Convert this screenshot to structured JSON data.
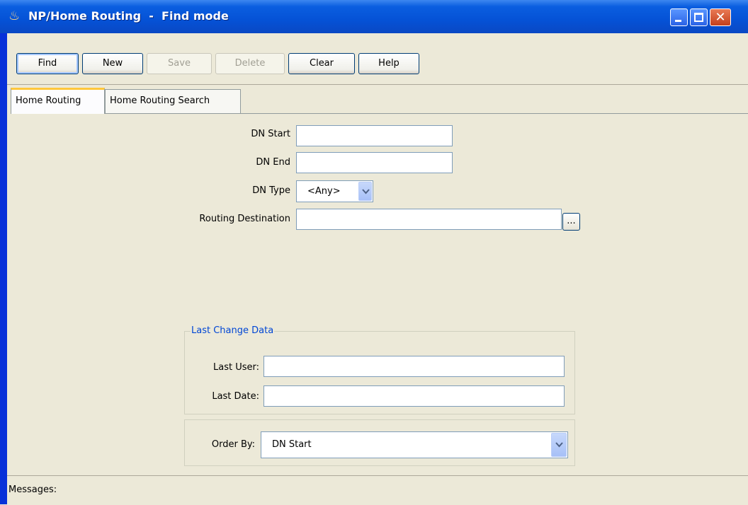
{
  "window": {
    "title": "NP/Home Routing  -  Find mode",
    "app_icon": "java-cup-icon",
    "controls": {
      "minimize": "minimize-icon",
      "maximize": "maximize-icon",
      "close": "close-icon",
      "close_glyph": "✕"
    }
  },
  "toolbar": {
    "find": "Find",
    "new": "New",
    "save": "Save",
    "delete": "Delete",
    "clear": "Clear",
    "help": "Help"
  },
  "tabs": [
    {
      "label": "Home Routing",
      "active": true
    },
    {
      "label": "Home Routing Search",
      "active": false
    }
  ],
  "form": {
    "dn_start": {
      "label": "DN Start",
      "value": ""
    },
    "dn_end": {
      "label": "DN End",
      "value": ""
    },
    "dn_type": {
      "label": "DN Type",
      "value": "<Any>"
    },
    "routing_destination": {
      "label": "Routing Destination",
      "value": "",
      "browse_label": "..."
    }
  },
  "last_change": {
    "legend": "Last Change Data",
    "last_user": {
      "label": "Last User:",
      "value": ""
    },
    "last_date": {
      "label": "Last Date:",
      "value": ""
    }
  },
  "order_by": {
    "label": "Order By:",
    "value": "DN Start"
  },
  "messages": {
    "label": "Messages:"
  },
  "colors": {
    "title_bar": "#0552d6",
    "window_bg": "#ece9d8",
    "tab_highlight": "#ffc73c",
    "group_legend": "#0046d5"
  }
}
